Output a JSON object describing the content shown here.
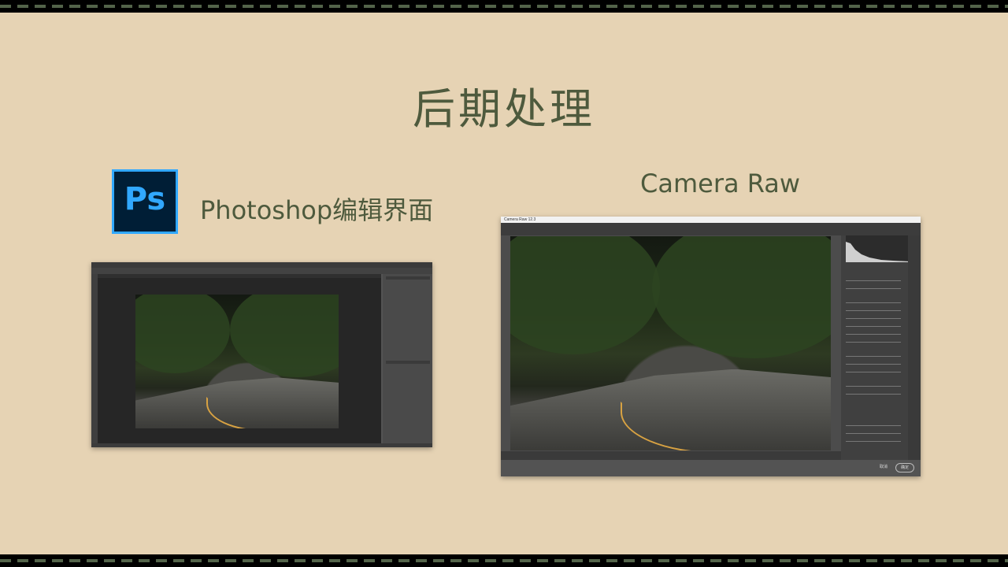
{
  "slide": {
    "title": "后期处理",
    "ps_logo_text": "Ps",
    "ps_label": "Photoshop编辑界面",
    "cr_label": "Camera Raw"
  },
  "camera_raw": {
    "window_title": "Camera Raw 12.3",
    "done_label": "确定",
    "cancel_label": "取消"
  },
  "colors": {
    "background": "#e6d3b4",
    "text": "#4e5a3d",
    "band": "#000000",
    "dash": "#53634a",
    "ps_blue": "#31a8ff",
    "ps_navy": "#001e36"
  }
}
